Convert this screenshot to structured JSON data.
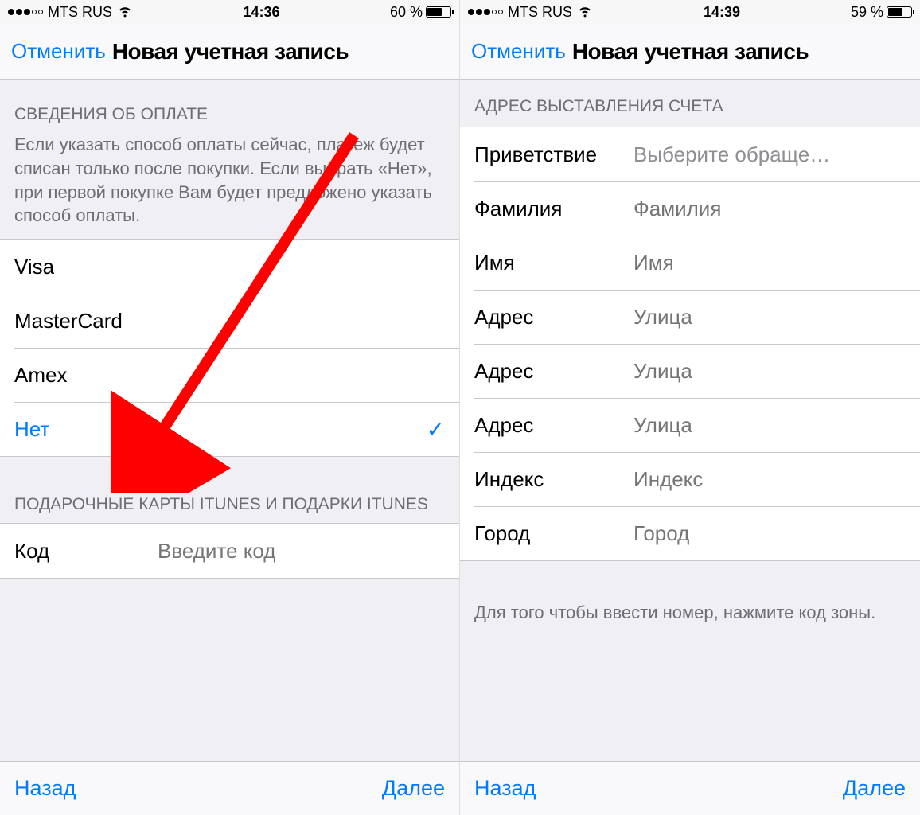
{
  "left": {
    "status": {
      "carrier": "MTS RUS",
      "time": "14:36",
      "battery_pct": "60 %",
      "battery_fill": 60
    },
    "nav": {
      "cancel": "Отменить",
      "title": "Новая учетная запись"
    },
    "payment": {
      "header": "СВЕДЕНИЯ ОБ ОПЛАТЕ",
      "desc": "Если указать способ оплаты сейчас, платеж будет списан только после покупки. Если выбрать «Нет», при первой покупке Вам будет предложено указать способ оплаты.",
      "options": [
        {
          "label": "Visa",
          "selected": false
        },
        {
          "label": "MasterCard",
          "selected": false
        },
        {
          "label": "Amex",
          "selected": false
        },
        {
          "label": "Нет",
          "selected": true
        }
      ]
    },
    "gift": {
      "header": "ПОДАРОЧНЫЕ КАРТЫ ITUNES И ПОДАРКИ ITUNES",
      "code_label": "Код",
      "code_placeholder": "Введите код"
    },
    "toolbar": {
      "back": "Назад",
      "next": "Далее"
    }
  },
  "right": {
    "status": {
      "carrier": "MTS RUS",
      "time": "14:39",
      "battery_pct": "59 %",
      "battery_fill": 59
    },
    "nav": {
      "cancel": "Отменить",
      "title": "Новая учетная запись"
    },
    "billing": {
      "header": "АДРЕС ВЫСТАВЛЕНИЯ СЧЕТА",
      "fields": [
        {
          "label": "Приветствие",
          "placeholder": "Выберите обраще…"
        },
        {
          "label": "Фамилия",
          "placeholder": "Фамилия"
        },
        {
          "label": "Имя",
          "placeholder": "Имя"
        },
        {
          "label": "Адрес",
          "placeholder": "Улица"
        },
        {
          "label": "Адрес",
          "placeholder": "Улица"
        },
        {
          "label": "Адрес",
          "placeholder": "Улица"
        },
        {
          "label": "Индекс",
          "placeholder": "Индекс"
        },
        {
          "label": "Город",
          "placeholder": "Город"
        }
      ],
      "footer": "Для того чтобы ввести номер, нажмите код зоны."
    },
    "toolbar": {
      "back": "Назад",
      "next": "Далее"
    }
  }
}
